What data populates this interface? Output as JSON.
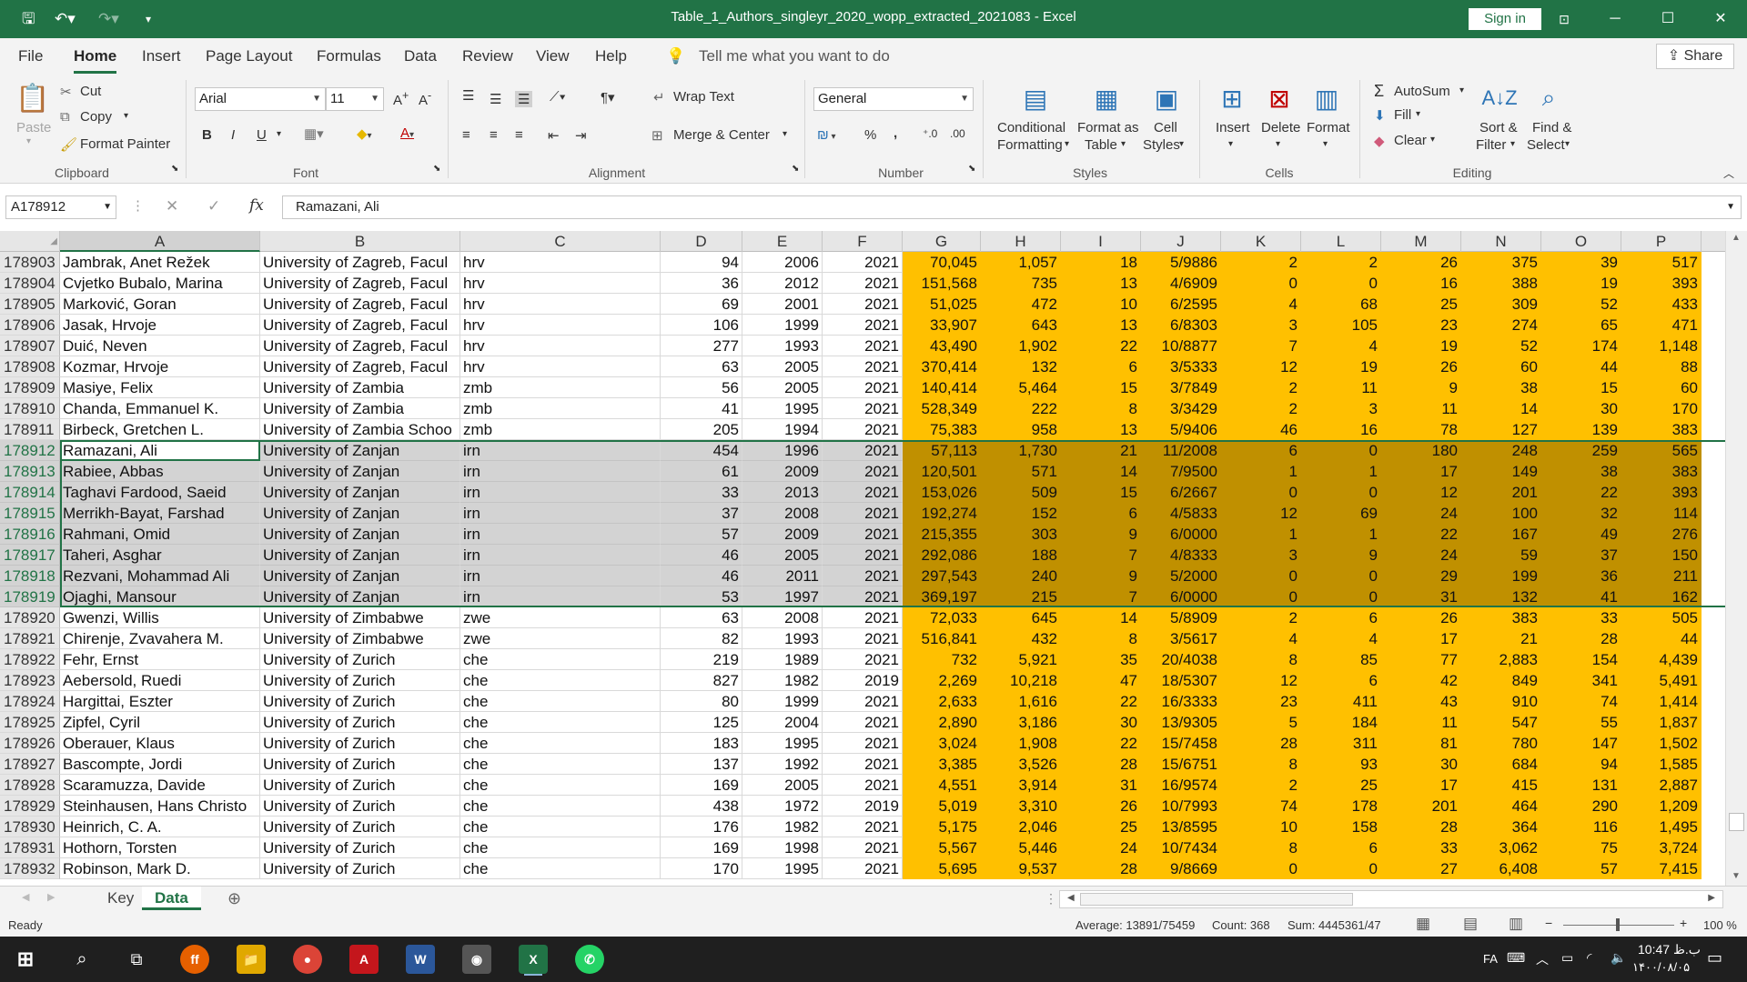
{
  "titlebar": {
    "title": "Table_1_Authors_singleyr_2020_wopp_extracted_2021083  -  Excel",
    "sign_in": "Sign in",
    "minimize": "─",
    "maximize": "☐",
    "close": "✕"
  },
  "menu": {
    "tabs": [
      "File",
      "Home",
      "Insert",
      "Page Layout",
      "Formulas",
      "Data",
      "Review",
      "View",
      "Help"
    ],
    "tell_me": "Tell me what you want to do",
    "share": "Share"
  },
  "ribbon": {
    "clipboard": {
      "paste": "Paste",
      "cut": "Cut",
      "copy": "Copy",
      "format_painter": "Format Painter",
      "label": "Clipboard"
    },
    "font": {
      "name": "Arial",
      "size": "11",
      "label": "Font"
    },
    "alignment": {
      "wrap": "Wrap Text",
      "merge": "Merge & Center",
      "label": "Alignment"
    },
    "number": {
      "format": "General",
      "label": "Number"
    },
    "styles": {
      "cond1": "Conditional",
      "cond2": "Formatting",
      "fat1": "Format as",
      "fat2": "Table",
      "cell1": "Cell",
      "cell2": "Styles",
      "label": "Styles"
    },
    "cells": {
      "insert": "Insert",
      "delete": "Delete",
      "format": "Format",
      "label": "Cells"
    },
    "editing": {
      "autosum": "AutoSum",
      "fill": "Fill",
      "clear": "Clear",
      "sort1": "Sort &",
      "sort2": "Filter",
      "find1": "Find &",
      "find2": "Select",
      "label": "Editing"
    }
  },
  "formula_bar": {
    "name_box": "A178912",
    "value": "Ramazani, Ali",
    "fx": "fx"
  },
  "columns": [
    "A",
    "B",
    "C",
    "D",
    "E",
    "F",
    "G",
    "H",
    "I",
    "J",
    "K",
    "L",
    "M",
    "N",
    "O",
    "P"
  ],
  "rows": [
    [
      "178903",
      "Jambrak, Anet Režek",
      "University of Zagreb, Facul",
      "hrv",
      "94",
      "2006",
      "2021",
      "70,045",
      "1,057",
      "18",
      "5/9886",
      "2",
      "2",
      "26",
      "375",
      "39",
      "517"
    ],
    [
      "178904",
      "Cvjetko Bubalo, Marina",
      "University of Zagreb, Facul",
      "hrv",
      "36",
      "2012",
      "2021",
      "151,568",
      "735",
      "13",
      "4/6909",
      "0",
      "0",
      "16",
      "388",
      "19",
      "393"
    ],
    [
      "178905",
      "Marković, Goran",
      "University of Zagreb, Facul",
      "hrv",
      "69",
      "2001",
      "2021",
      "51,025",
      "472",
      "10",
      "6/2595",
      "4",
      "68",
      "25",
      "309",
      "52",
      "433"
    ],
    [
      "178906",
      "Jasak, Hrvoje",
      "University of Zagreb, Facul",
      "hrv",
      "106",
      "1999",
      "2021",
      "33,907",
      "643",
      "13",
      "6/8303",
      "3",
      "105",
      "23",
      "274",
      "65",
      "471"
    ],
    [
      "178907",
      "Duić, Neven",
      "University of Zagreb, Facul",
      "hrv",
      "277",
      "1993",
      "2021",
      "43,490",
      "1,902",
      "22",
      "10/8877",
      "7",
      "4",
      "19",
      "52",
      "174",
      "1,148"
    ],
    [
      "178908",
      "Kozmar, Hrvoje",
      "University of Zagreb, Facul",
      "hrv",
      "63",
      "2005",
      "2021",
      "370,414",
      "132",
      "6",
      "3/5333",
      "12",
      "19",
      "26",
      "60",
      "44",
      "88"
    ],
    [
      "178909",
      "Masiye, Felix",
      "University of Zambia",
      "zmb",
      "56",
      "2005",
      "2021",
      "140,414",
      "5,464",
      "15",
      "3/7849",
      "2",
      "11",
      "9",
      "38",
      "15",
      "60"
    ],
    [
      "178910",
      "Chanda, Emmanuel K.",
      "University of Zambia",
      "zmb",
      "41",
      "1995",
      "2021",
      "528,349",
      "222",
      "8",
      "3/3429",
      "2",
      "3",
      "11",
      "14",
      "30",
      "170"
    ],
    [
      "178911",
      "Birbeck, Gretchen L.",
      "University of Zambia Schoo",
      "zmb",
      "205",
      "1994",
      "2021",
      "75,383",
      "958",
      "13",
      "5/9406",
      "46",
      "16",
      "78",
      "127",
      "139",
      "383"
    ],
    [
      "178912",
      "Ramazani, Ali",
      "University of Zanjan",
      "irn",
      "454",
      "1996",
      "2021",
      "57,113",
      "1,730",
      "21",
      "11/2008",
      "6",
      "0",
      "180",
      "248",
      "259",
      "565"
    ],
    [
      "178913",
      "Rabiee, Abbas",
      "University of Zanjan",
      "irn",
      "61",
      "2009",
      "2021",
      "120,501",
      "571",
      "14",
      "7/9500",
      "1",
      "1",
      "17",
      "149",
      "38",
      "383"
    ],
    [
      "178914",
      "Taghavi Fardood, Saeid",
      "University of Zanjan",
      "irn",
      "33",
      "2013",
      "2021",
      "153,026",
      "509",
      "15",
      "6/2667",
      "0",
      "0",
      "12",
      "201",
      "22",
      "393"
    ],
    [
      "178915",
      "Merrikh-Bayat, Farshad",
      "University of Zanjan",
      "irn",
      "37",
      "2008",
      "2021",
      "192,274",
      "152",
      "6",
      "4/5833",
      "12",
      "69",
      "24",
      "100",
      "32",
      "114"
    ],
    [
      "178916",
      "Rahmani, Omid",
      "University of Zanjan",
      "irn",
      "57",
      "2009",
      "2021",
      "215,355",
      "303",
      "9",
      "6/0000",
      "1",
      "1",
      "22",
      "167",
      "49",
      "276"
    ],
    [
      "178917",
      "Taheri, Asghar",
      "University of Zanjan",
      "irn",
      "46",
      "2005",
      "2021",
      "292,086",
      "188",
      "7",
      "4/8333",
      "3",
      "9",
      "24",
      "59",
      "37",
      "150"
    ],
    [
      "178918",
      "Rezvani, Mohammad Ali",
      "University of Zanjan",
      "irn",
      "46",
      "2011",
      "2021",
      "297,543",
      "240",
      "9",
      "5/2000",
      "0",
      "0",
      "29",
      "199",
      "36",
      "211"
    ],
    [
      "178919",
      "Ojaghi, Mansour",
      "University of Zanjan",
      "irn",
      "53",
      "1997",
      "2021",
      "369,197",
      "215",
      "7",
      "6/0000",
      "0",
      "0",
      "31",
      "132",
      "41",
      "162"
    ],
    [
      "178920",
      "Gwenzi, Willis",
      "University of Zimbabwe",
      "zwe",
      "63",
      "2008",
      "2021",
      "72,033",
      "645",
      "14",
      "5/8909",
      "2",
      "6",
      "26",
      "383",
      "33",
      "505"
    ],
    [
      "178921",
      "Chirenje, Zvavahera M.",
      "University of Zimbabwe",
      "zwe",
      "82",
      "1993",
      "2021",
      "516,841",
      "432",
      "8",
      "3/5617",
      "4",
      "4",
      "17",
      "21",
      "28",
      "44"
    ],
    [
      "178922",
      "Fehr, Ernst",
      "University of Zurich",
      "che",
      "219",
      "1989",
      "2021",
      "732",
      "5,921",
      "35",
      "20/4038",
      "8",
      "85",
      "77",
      "2,883",
      "154",
      "4,439"
    ],
    [
      "178923",
      "Aebersold, Ruedi",
      "University of Zurich",
      "che",
      "827",
      "1982",
      "2019",
      "2,269",
      "10,218",
      "47",
      "18/5307",
      "12",
      "6",
      "42",
      "849",
      "341",
      "5,491"
    ],
    [
      "178924",
      "Hargittai, Eszter",
      "University of Zurich",
      "che",
      "80",
      "1999",
      "2021",
      "2,633",
      "1,616",
      "22",
      "16/3333",
      "23",
      "411",
      "43",
      "910",
      "74",
      "1,414"
    ],
    [
      "178925",
      "Zipfel, Cyril",
      "University of Zurich",
      "che",
      "125",
      "2004",
      "2021",
      "2,890",
      "3,186",
      "30",
      "13/9305",
      "5",
      "184",
      "11",
      "547",
      "55",
      "1,837"
    ],
    [
      "178926",
      "Oberauer, Klaus",
      "University of Zurich",
      "che",
      "183",
      "1995",
      "2021",
      "3,024",
      "1,908",
      "22",
      "15/7458",
      "28",
      "311",
      "81",
      "780",
      "147",
      "1,502"
    ],
    [
      "178927",
      "Bascompte, Jordi",
      "University of Zurich",
      "che",
      "137",
      "1992",
      "2021",
      "3,385",
      "3,526",
      "28",
      "15/6751",
      "8",
      "93",
      "30",
      "684",
      "94",
      "1,585"
    ],
    [
      "178928",
      "Scaramuzza, Davide",
      "University of Zurich",
      "che",
      "169",
      "2005",
      "2021",
      "4,551",
      "3,914",
      "31",
      "16/9574",
      "2",
      "25",
      "17",
      "415",
      "131",
      "2,887"
    ],
    [
      "178929",
      "Steinhausen, Hans Christo",
      "University of Zurich",
      "che",
      "438",
      "1972",
      "2019",
      "5,019",
      "3,310",
      "26",
      "10/7993",
      "74",
      "178",
      "201",
      "464",
      "290",
      "1,209"
    ],
    [
      "178930",
      "Heinrich, C. A.",
      "University of Zurich",
      "che",
      "176",
      "1982",
      "2021",
      "5,175",
      "2,046",
      "25",
      "13/8595",
      "10",
      "158",
      "28",
      "364",
      "116",
      "1,495"
    ],
    [
      "178931",
      "Hothorn, Torsten",
      "University of Zurich",
      "che",
      "169",
      "1998",
      "2021",
      "5,567",
      "5,446",
      "24",
      "10/7434",
      "8",
      "6",
      "33",
      "3,062",
      "75",
      "3,724"
    ],
    [
      "178932",
      "Robinson, Mark D.",
      "University of Zurich",
      "che",
      "170",
      "1995",
      "2021",
      "5,695",
      "9,537",
      "28",
      "9/8669",
      "0",
      "0",
      "27",
      "6,408",
      "57",
      "7,415"
    ]
  ],
  "sheet_tabs": [
    "Key",
    "Data"
  ],
  "status": {
    "ready": "Ready",
    "average": "Average: 13891/75459",
    "count": "Count: 368",
    "sum": "Sum: 4445361/47",
    "zoom": "100 %"
  },
  "taskbar": {
    "lang": "FA",
    "time": "10:47 ب.ظ",
    "date": "۱۴۰۰/۰۸/۰۵"
  }
}
